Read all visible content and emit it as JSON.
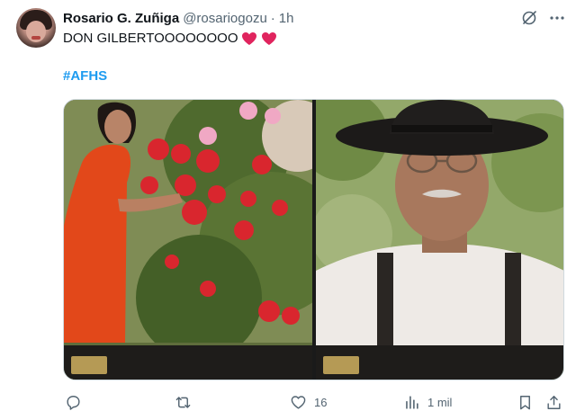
{
  "tweet": {
    "display_name": "Rosario G. Zuñiga",
    "handle": "@rosariogozu",
    "separator": "·",
    "time": "1h",
    "text": "DON GILBERTOOOOOOOO",
    "hashtag": "#AFHS",
    "media": [
      {
        "name": "photo-woman-with-flowers"
      },
      {
        "name": "photo-man-with-hat"
      }
    ],
    "actions": {
      "reply_count": "",
      "retweet_count": "",
      "like_count": "16",
      "views_count": "1 mil"
    }
  },
  "colors": {
    "accent": "#1d9bf0",
    "text": "#0f1419",
    "muted": "#536471",
    "heart": "#e0245e"
  },
  "icons": [
    "grok-icon",
    "more-icon",
    "heart-icon",
    "reply-icon",
    "retweet-icon",
    "like-icon",
    "views-icon",
    "bookmark-icon",
    "share-icon"
  ]
}
